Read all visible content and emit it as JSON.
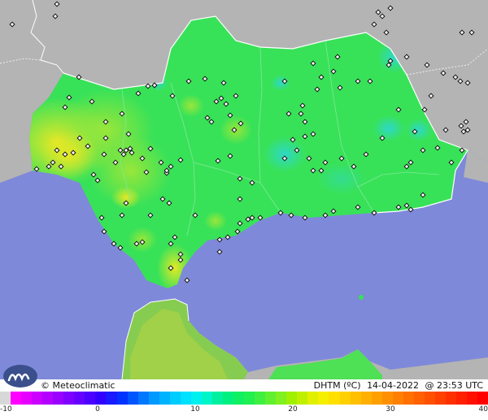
{
  "map": {
    "title": "DHTM (ºC)",
    "date": "14-04-2022",
    "time": "@ 23:53 UTC",
    "copyright": "© Meteoclimatic",
    "logo_icon": "meteoclimatic-logo-icon",
    "colors": {
      "sea": "#7f89d9",
      "outside_land": "#b4b4b4",
      "land_base": "#35e255",
      "border": "#ffffff",
      "marker": "#111111"
    }
  },
  "colorbar": {
    "range": [
      -10,
      40
    ],
    "ticks": [
      {
        "label": "-10",
        "value": -10
      },
      {
        "label": "0",
        "value": 0
      },
      {
        "label": "10",
        "value": 10
      },
      {
        "label": "20",
        "value": 20
      },
      {
        "label": "30",
        "value": 30
      },
      {
        "label": "40",
        "value": 40
      }
    ],
    "colors": [
      "#d8d8d8",
      "#ff00ff",
      "#e600ff",
      "#cc00ff",
      "#b300ff",
      "#9900ff",
      "#7f00ff",
      "#6600ff",
      "#4c00ff",
      "#3300ff",
      "#1a1aff",
      "#0033ff",
      "#0055ff",
      "#0077ff",
      "#0099ff",
      "#00b3ff",
      "#00ccff",
      "#00e0ff",
      "#00f0f0",
      "#00f5c8",
      "#00f0a0",
      "#00f080",
      "#10f060",
      "#20f050",
      "#40f040",
      "#60f030",
      "#80f020",
      "#a0f000",
      "#c0f000",
      "#e0f000",
      "#f5f000",
      "#ffe000",
      "#ffd000",
      "#ffc000",
      "#ffb000",
      "#ffa000",
      "#ff9000",
      "#ff8000",
      "#ff7000",
      "#ff6000",
      "#ff5000",
      "#ff4000",
      "#ff3000",
      "#ff2000",
      "#ff1000",
      "#ff0000"
    ]
  }
}
